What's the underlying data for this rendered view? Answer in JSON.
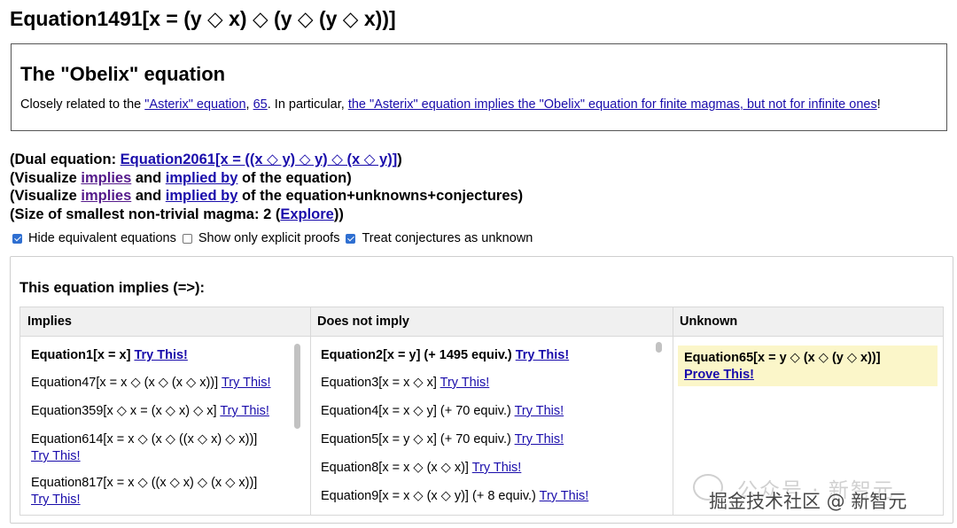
{
  "title": "Equation1491[x = (y ◇ x) ◇ (y ◇ (y ◇ x))]",
  "obelix": {
    "heading": "The \"Obelix\" equation",
    "text_prefix": "Closely related to the ",
    "link_asterix": "\"Asterix\" equation",
    "sep": ", ",
    "link_65": "65",
    "text_mid": ". In particular, ",
    "link_implies": "the \"Asterix\" equation implies the \"Obelix\" equation for finite magmas, but not for infinite ones",
    "text_end": "!"
  },
  "info": {
    "dual_prefix": "(Dual equation: ",
    "dual_link": "Equation2061[x = ((x ◇ y) ◇ y) ◇ (x ◇ y)]",
    "dual_suffix": ")",
    "viz1_prefix": "(Visualize ",
    "viz1_implies": "implies",
    "viz1_and": " and ",
    "viz1_implied_by": "implied by",
    "viz1_suffix": " of the equation)",
    "viz2_prefix": "(Visualize ",
    "viz2_implies": "implies",
    "viz2_and": " and ",
    "viz2_implied_by": "implied by",
    "viz2_suffix": " of the equation+unknowns+conjectures)",
    "size_prefix": "(Size of smallest non-trivial magma: 2 (",
    "size_link": "Explore",
    "size_suffix": "))"
  },
  "options": [
    {
      "label": "Hide equivalent equations",
      "checked": true
    },
    {
      "label": "Show only explicit proofs",
      "checked": false
    },
    {
      "label": "Treat conjectures as unknown",
      "checked": true
    }
  ],
  "panel": {
    "heading": "This equation implies (=>):",
    "columns": {
      "implies": "Implies",
      "not_imply": "Does not imply",
      "unknown": "Unknown"
    },
    "try_label": "Try This!",
    "implies_items": [
      {
        "eq": "Equation1[x = x]",
        "bold": true
      },
      {
        "eq": "Equation47[x = x ◇ (x ◇ (x ◇ x))]"
      },
      {
        "eq": "Equation359[x ◇ x = (x ◇ x) ◇ x]"
      },
      {
        "eq": "Equation614[x = x ◇ (x ◇ ((x ◇ x) ◇ x))]"
      },
      {
        "eq": "Equation817[x = x ◇ ((x ◇ x) ◇ (x ◇ x))]"
      }
    ],
    "not_imply_items": [
      {
        "eq": "Equation2[x = y] (+ 1495 equiv.)",
        "bold": true
      },
      {
        "eq": "Equation3[x = x ◇ x]"
      },
      {
        "eq": "Equation4[x = x ◇ y] (+ 70 equiv.)"
      },
      {
        "eq": "Equation5[x = y ◇ x] (+ 70 equiv.)"
      },
      {
        "eq": "Equation8[x = x ◇ (x ◇ x)]"
      },
      {
        "eq": "Equation9[x = x ◇ (x ◇ y)] (+ 8 equiv.)"
      }
    ],
    "unknown_items": [
      {
        "eq": "Equation65[x = y ◇ (x ◇ (y ◇ x))]",
        "action": "Prove This!"
      }
    ]
  },
  "watermark": {
    "line1": "公众号 · 新智元",
    "line2": "掘金技术社区 @ 新智元"
  }
}
